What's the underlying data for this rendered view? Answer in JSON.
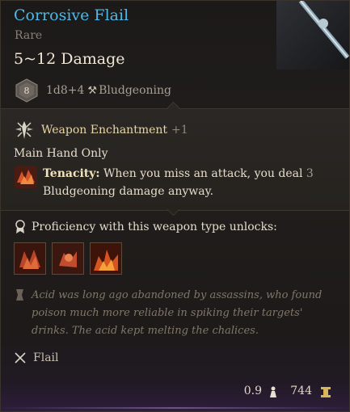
{
  "item": {
    "name": "Corrosive Flail",
    "rarity": "Rare",
    "damage": "5~12 Damage",
    "die_face": "8",
    "dice": "1d8+4",
    "damage_type": "Bludgeoning"
  },
  "enchantment": {
    "label": "Weapon Enchantment",
    "bonus": "+1"
  },
  "restriction": "Main Hand Only",
  "passive": {
    "name": "Tenacity:",
    "description_pre": "When you miss an attack, you deal",
    "amount": "3",
    "damage_type": "Bludgeoning damage",
    "description_post": "anyway."
  },
  "proficiency": {
    "label": "Proficiency with this weapon type unlocks:",
    "actions": [
      "action-icon-1",
      "action-icon-2",
      "action-icon-3"
    ]
  },
  "lore": "Acid was long ago abandoned by assassins, who found poison much more reliable in spiking their targets' drinks. The acid kept melting the chalices.",
  "weapon_type": "Flail",
  "footer": {
    "weight": "0.9",
    "value": "744"
  },
  "colors": {
    "title": "#4fb8e6",
    "enchant": "#e7d7a8",
    "background": "#1f1c1a"
  }
}
